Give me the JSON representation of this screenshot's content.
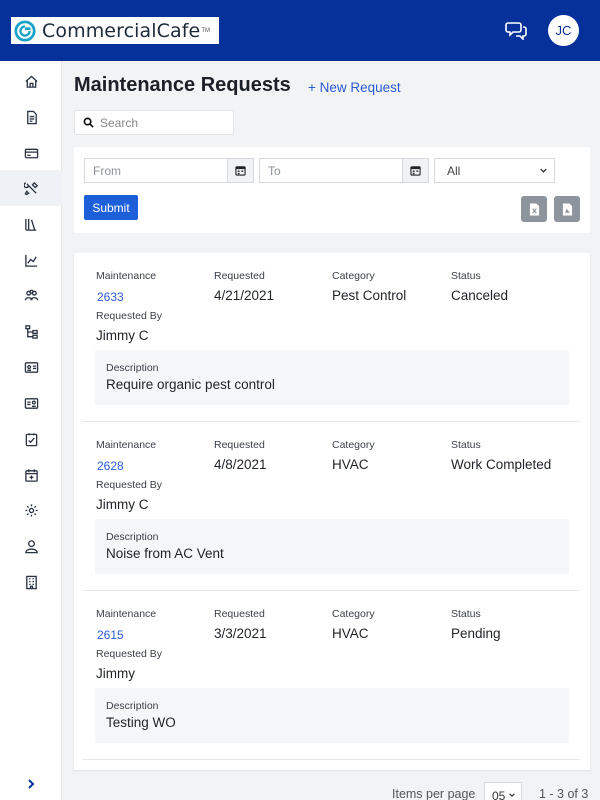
{
  "header": {
    "logo_text": "CommercialCafe",
    "logo_tm": "TM",
    "avatar_initials": "JC"
  },
  "sidebar": {
    "items": [
      {
        "icon": "home-icon"
      },
      {
        "icon": "document-icon"
      },
      {
        "icon": "payment-card-icon"
      },
      {
        "icon": "tools-icon",
        "active": true
      },
      {
        "icon": "library-icon"
      },
      {
        "icon": "chart-icon"
      },
      {
        "icon": "people-icon"
      },
      {
        "icon": "hierarchy-icon"
      },
      {
        "icon": "id-card-icon"
      },
      {
        "icon": "contact-card-icon"
      },
      {
        "icon": "checklist-icon"
      },
      {
        "icon": "calendar-add-icon"
      },
      {
        "icon": "settings-icon"
      },
      {
        "icon": "user-icon"
      },
      {
        "icon": "building-icon"
      }
    ],
    "collapse_icon": "chevron-right-icon"
  },
  "page": {
    "title": "Maintenance Requests",
    "new_request_label": "+ New Request"
  },
  "search": {
    "placeholder": "Search"
  },
  "filters": {
    "from_placeholder": "From",
    "to_placeholder": "To",
    "status_selected": "All",
    "submit_label": "Submit"
  },
  "labels": {
    "maintenance": "Maintenance",
    "requested": "Requested",
    "category": "Category",
    "status": "Status",
    "requested_by": "Requested By",
    "description": "Description"
  },
  "requests": [
    {
      "id": "2633",
      "requested": "4/21/2021",
      "category": "Pest Control",
      "status": "Canceled",
      "requested_by": "Jimmy C",
      "description": "Require organic pest control"
    },
    {
      "id": "2628",
      "requested": "4/8/2021",
      "category": "HVAC",
      "status": "Work Completed",
      "requested_by": "Jimmy C",
      "description": "Noise from AC Vent"
    },
    {
      "id": "2615",
      "requested": "3/3/2021",
      "category": "HVAC",
      "status": "Pending",
      "requested_by": "Jimmy",
      "description": "Testing WO"
    }
  ],
  "pagination": {
    "items_per_page_label": "Items per page",
    "per_page_value": "05",
    "range": "1 - 3 of 3"
  },
  "colors": {
    "header_bg": "#06309a",
    "accent": "#1d5fd8",
    "link": "#2a5bd7"
  }
}
